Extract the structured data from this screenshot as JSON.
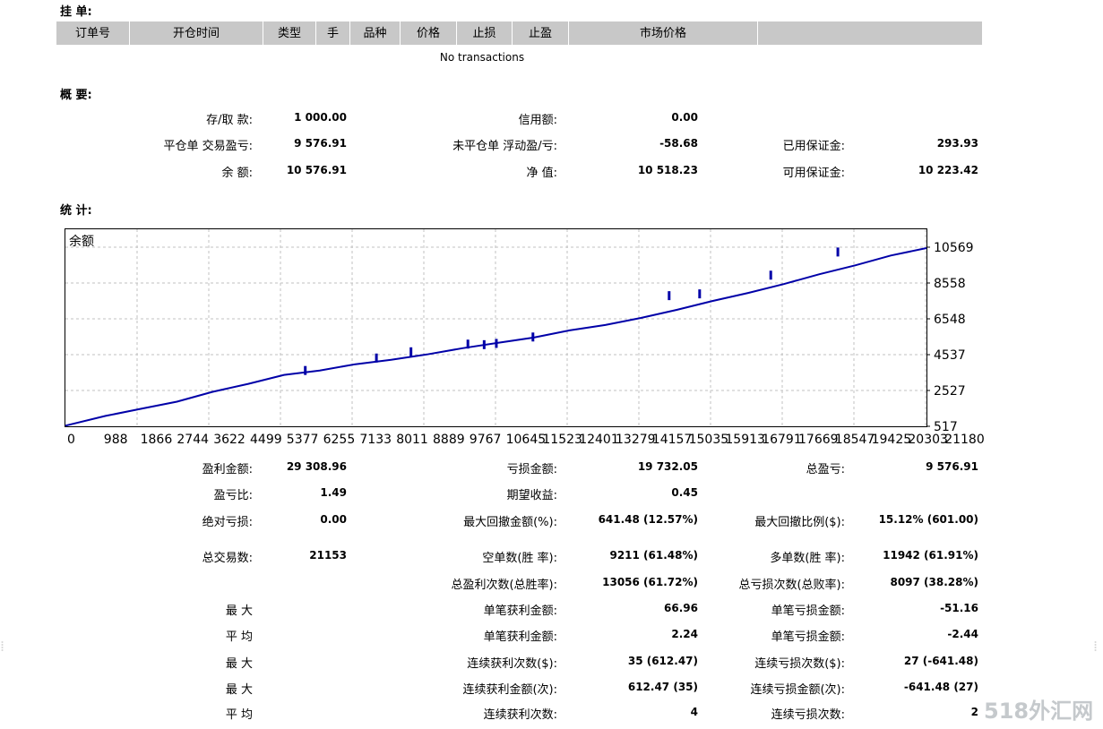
{
  "pending": {
    "title": "挂 单:",
    "columns": [
      "订单号",
      "开仓时间",
      "类型",
      "手",
      "品种",
      "价格",
      "止损",
      "止盈",
      "市场价格",
      ""
    ],
    "empty_text": "No transactions"
  },
  "summary": {
    "title": "概 要:",
    "rows": [
      [
        {
          "label": "存/取 款:",
          "value": "1 000.00"
        },
        {
          "label": "信用额:",
          "value": "0.00"
        },
        {
          "label": "",
          "value": ""
        }
      ],
      [
        {
          "label": "平仓单 交易盈亏:",
          "value": "9 576.91"
        },
        {
          "label": "未平仓单 浮动盈/亏:",
          "value": "-58.68"
        },
        {
          "label": "已用保证金:",
          "value": "293.93"
        }
      ],
      [
        {
          "label": "余 额:",
          "value": "10 576.91"
        },
        {
          "label": "净 值:",
          "value": "10 518.23"
        },
        {
          "label": "可用保证金:",
          "value": "10 223.42"
        }
      ]
    ]
  },
  "stats": {
    "title": "统 计:",
    "rows": [
      [
        {
          "label": "盈利金额:",
          "value": "29 308.96"
        },
        {
          "label": "亏损金额:",
          "value": "19 732.05"
        },
        {
          "label": "总盈亏:",
          "value": "9 576.91"
        }
      ],
      [
        {
          "label": "盈亏比:",
          "value": "1.49"
        },
        {
          "label": "期望收益:",
          "value": "0.45"
        },
        {
          "label": "",
          "value": ""
        }
      ],
      [
        {
          "label": "绝对亏损:",
          "value": "0.00"
        },
        {
          "label": "最大回撤金额(%):",
          "value": "641.48 (12.57%)"
        },
        {
          "label": "最大回撤比例($):",
          "value": "15.12% (601.00)"
        }
      ],
      [
        {
          "label": "总交易数:",
          "value": "21153"
        },
        {
          "label": "空单数(胜 率):",
          "value": "9211 (61.48%)"
        },
        {
          "label": "多单数(胜 率):",
          "value": "11942 (61.91%)"
        }
      ],
      [
        {
          "label": "",
          "value": ""
        },
        {
          "label": "总盈利次数(总胜率):",
          "value": "13056 (61.72%)"
        },
        {
          "label": "总亏损次数(总败率):",
          "value": "8097 (38.28%)"
        }
      ],
      [
        {
          "label": "最 大",
          "value": ""
        },
        {
          "label": "单笔获利金额:",
          "value": "66.96"
        },
        {
          "label": "单笔亏损金额:",
          "value": "-51.16"
        }
      ],
      [
        {
          "label": "平 均",
          "value": ""
        },
        {
          "label": "单笔获利金额:",
          "value": "2.24"
        },
        {
          "label": "单笔亏损金额:",
          "value": "-2.44"
        }
      ],
      [
        {
          "label": "最 大",
          "value": ""
        },
        {
          "label": "连续获利次数($):",
          "value": "35 (612.47)"
        },
        {
          "label": "连续亏损次数($):",
          "value": "27 (-641.48)"
        }
      ],
      [
        {
          "label": "最 大",
          "value": ""
        },
        {
          "label": "连续获利金额(次):",
          "value": "612.47 (35)"
        },
        {
          "label": "连续亏损金额(次):",
          "value": "-641.48 (27)"
        }
      ],
      [
        {
          "label": "平 均",
          "value": ""
        },
        {
          "label": "连续获利次数:",
          "value": "4"
        },
        {
          "label": "连续亏损次数:",
          "value": "2"
        }
      ]
    ]
  },
  "chart_data": {
    "type": "line",
    "title": "余额",
    "xlabel": "",
    "ylabel": "",
    "x_ticks": [
      "0",
      "988",
      "1866",
      "2744",
      "3622",
      "4499",
      "5377",
      "6255",
      "7133",
      "8011",
      "8889",
      "9767",
      "10645",
      "11523",
      "12401",
      "13279",
      "14157",
      "15035",
      "15913",
      "16791",
      "17669",
      "18547",
      "19425",
      "20303",
      "21180"
    ],
    "y_ticks": [
      517,
      2527,
      4537,
      6548,
      8558,
      10569
    ],
    "xlim": [
      0,
      21180
    ],
    "ylim": [
      517,
      10569
    ],
    "grid": true,
    "series": [
      {
        "color": "#0000a8",
        "points": [
          [
            0,
            550
          ],
          [
            988,
            1100
          ],
          [
            1866,
            1500
          ],
          [
            2744,
            1900
          ],
          [
            3622,
            2450
          ],
          [
            4499,
            2900
          ],
          [
            5377,
            3400
          ],
          [
            6255,
            3650
          ],
          [
            7133,
            4000
          ],
          [
            8011,
            4250
          ],
          [
            8889,
            4550
          ],
          [
            9767,
            4900
          ],
          [
            10645,
            5200
          ],
          [
            11523,
            5500
          ],
          [
            12401,
            5900
          ],
          [
            13279,
            6200
          ],
          [
            14157,
            6600
          ],
          [
            15035,
            7050
          ],
          [
            15913,
            7550
          ],
          [
            16791,
            8000
          ],
          [
            17669,
            8500
          ],
          [
            18547,
            9050
          ],
          [
            19425,
            9550
          ],
          [
            20303,
            10100
          ],
          [
            21180,
            10519
          ]
        ]
      }
    ],
    "spikes": [
      [
        5900,
        3900
      ],
      [
        7650,
        4600
      ],
      [
        8500,
        4950
      ],
      [
        9900,
        5380
      ],
      [
        10300,
        5350
      ],
      [
        10600,
        5420
      ],
      [
        11500,
        5780
      ],
      [
        14850,
        8100
      ],
      [
        15600,
        8200
      ],
      [
        17350,
        9250
      ],
      [
        19000,
        10550
      ]
    ]
  },
  "watermark": {
    "logo_text": "518外汇网"
  },
  "colors": {
    "header_bg": "#c8c8c8",
    "line": "#0000a8",
    "grid": "#c0c0c0"
  }
}
